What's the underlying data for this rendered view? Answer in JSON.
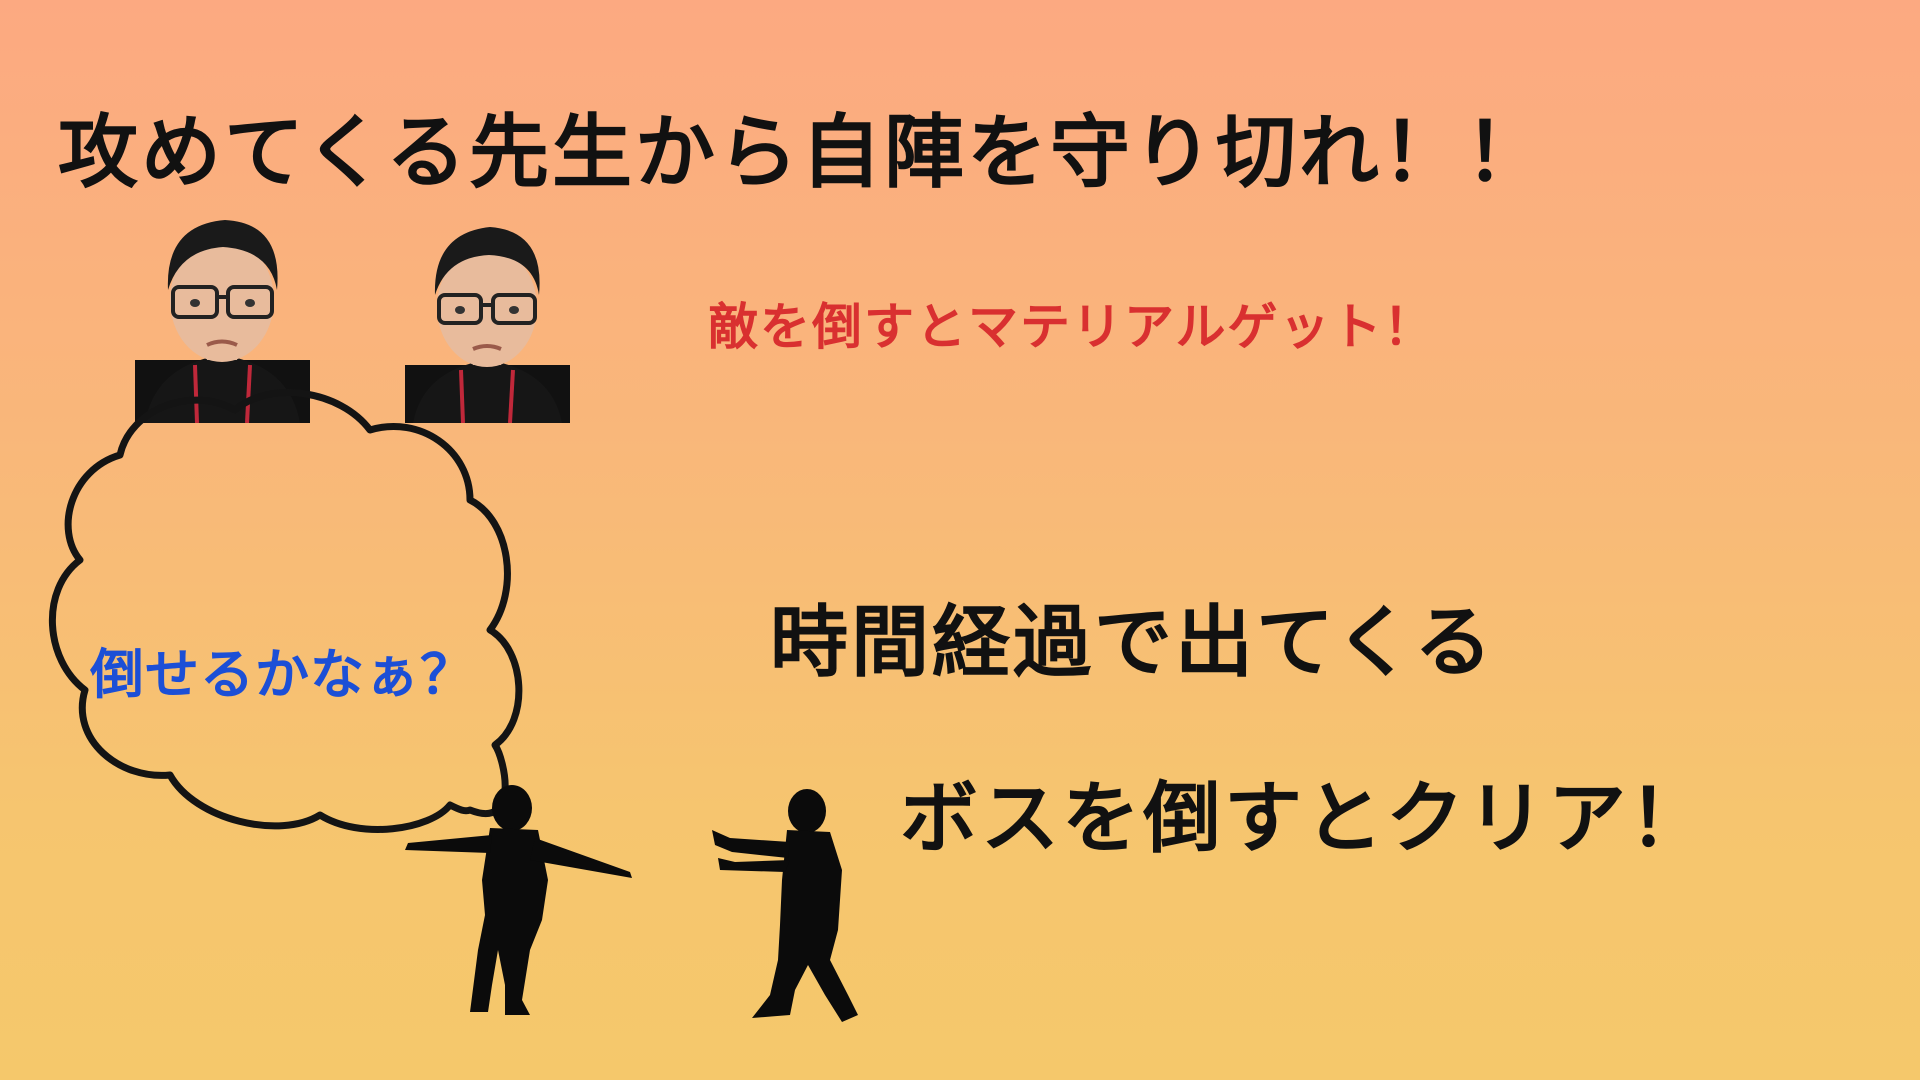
{
  "title": "攻めてくる先生から自陣を守り切れ！！",
  "enemy_note": "敵を倒すとマテリアルゲット！",
  "boss_line1": "時間経過で出てくる",
  "boss_line2": "ボスを倒すとクリア！",
  "bubble_text": "倒せるかなぁ？",
  "colors": {
    "background_top": "#fca981",
    "background_bottom": "#f5c86b",
    "title": "#111111",
    "enemy_note": "#d93030",
    "bubble_text": "#1c4fd6",
    "lanyard": "#c0283a"
  },
  "images": {
    "teacher_1": "teacher-face-photo",
    "teacher_2": "teacher-face-photo",
    "player_silhouette": "person-silhouette-arms-out",
    "enemy_silhouette": "person-silhouette-walking"
  }
}
